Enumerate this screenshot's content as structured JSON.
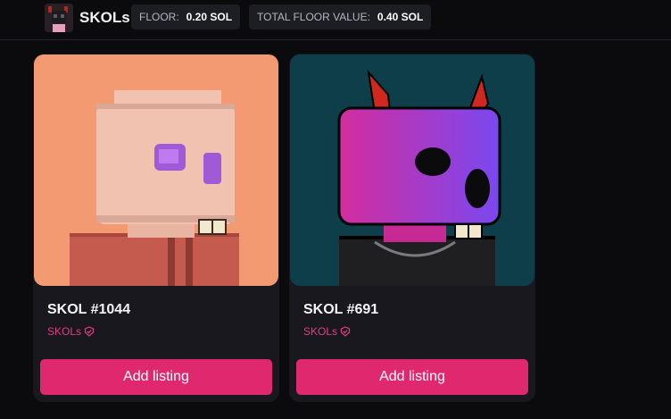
{
  "header": {
    "collection_name": "SKOLs",
    "floor": {
      "label": "FLOOR:",
      "value": "0.20 SOL"
    },
    "total_floor": {
      "label": "TOTAL FLOOR VALUE:",
      "value": "0.40 SOL"
    }
  },
  "cards": [
    {
      "title": "SKOL #1044",
      "collection": "SKOLs",
      "button_label": "Add listing",
      "art_bg": "#f49a73",
      "skull_color": "#f2c2b0",
      "eye_color": "#a05ad8",
      "shirt_color": "#c55b4f"
    },
    {
      "title": "SKOL #691",
      "collection": "SKOLs",
      "button_label": "Add listing",
      "art_bg": "#0d3e4a",
      "skull_color": "#d32d9e",
      "skull_color_2": "#7a48f0",
      "horn_color": "#d0281e",
      "shirt_color": "#1f1f22"
    }
  ],
  "colors": {
    "accent": "#e0286f",
    "collection_link": "#e43d86",
    "card_bg": "#18181e",
    "page_bg": "#0b0b0e"
  }
}
